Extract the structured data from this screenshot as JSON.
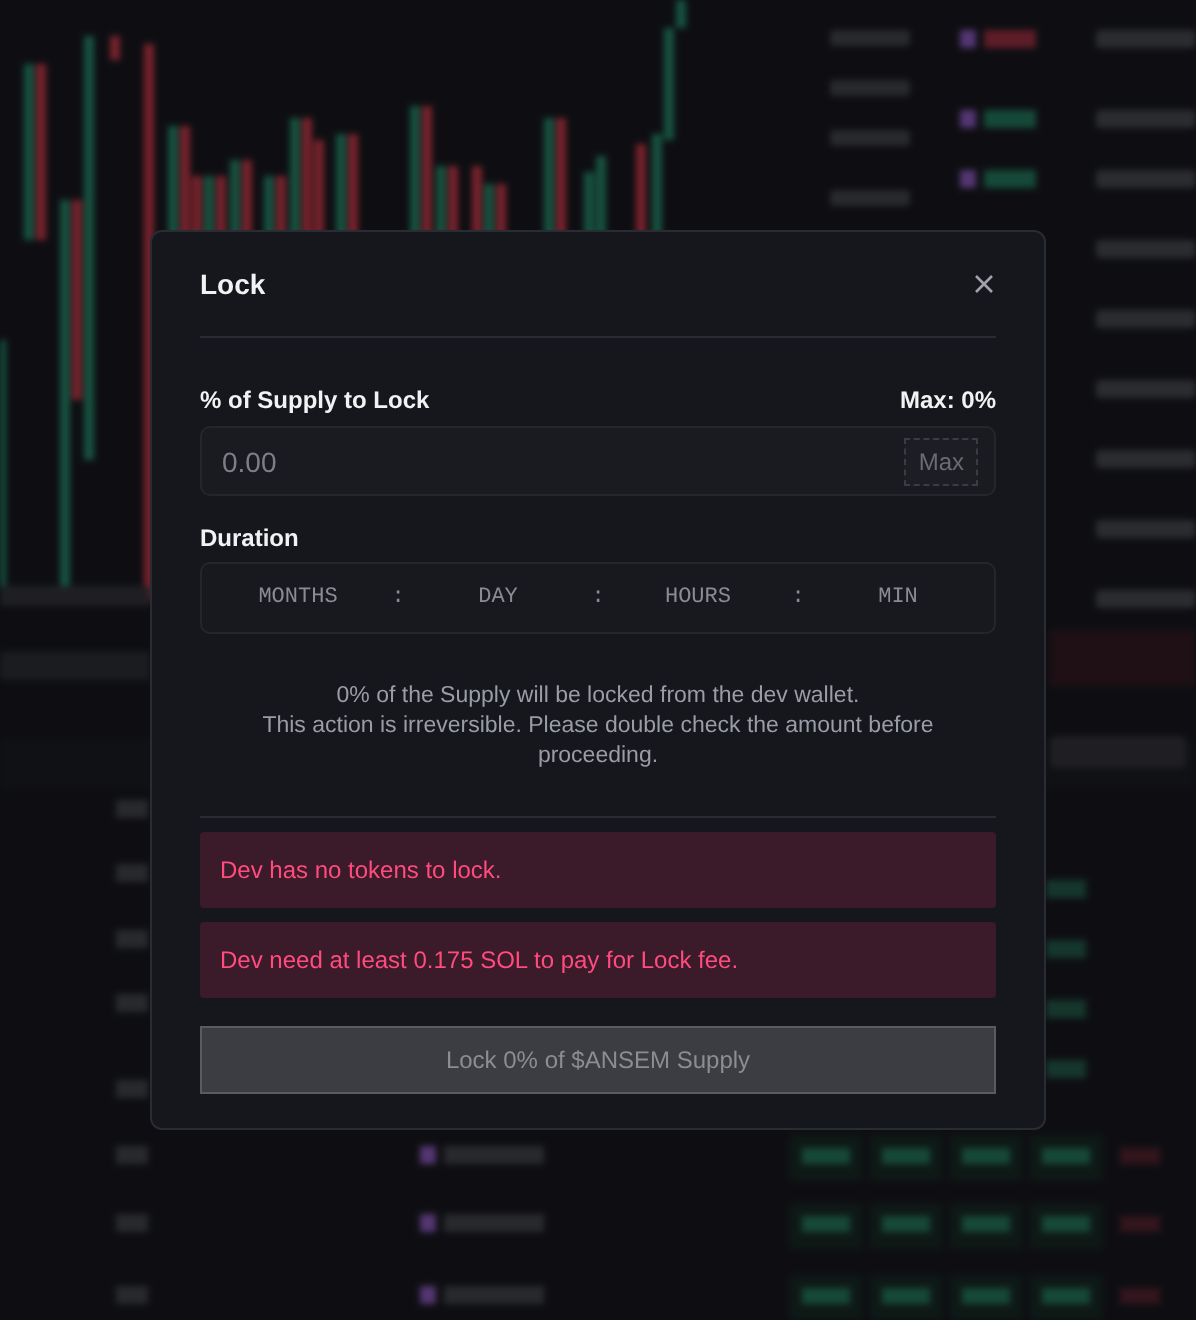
{
  "modal": {
    "title": "Lock",
    "supply": {
      "label": "% of Supply to Lock",
      "max_note": "Max: 0%",
      "placeholder": "0.00",
      "max_button": "Max"
    },
    "duration": {
      "label": "Duration",
      "separator": ":",
      "fields": [
        {
          "placeholder": "MONTHS"
        },
        {
          "placeholder": "DAY"
        },
        {
          "placeholder": "HOURS"
        },
        {
          "placeholder": "MIN"
        }
      ]
    },
    "notice": [
      "0% of the Supply will be locked from the dev wallet.",
      "This action is irreversible. Please double check the amount before proceeding."
    ],
    "alerts": [
      {
        "kind": "error",
        "text": "Dev has no tokens to lock."
      },
      {
        "kind": "error",
        "text": "Dev need at least 0.175 SOL to pay for Lock fee."
      }
    ],
    "submit": {
      "label": "Lock 0% of $ANSEM Supply",
      "disabled": true
    }
  }
}
